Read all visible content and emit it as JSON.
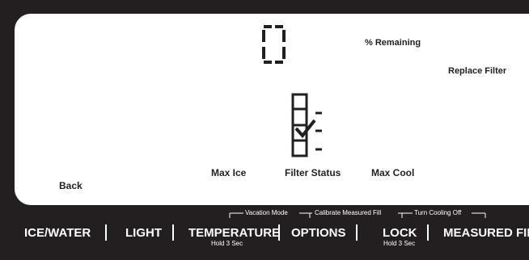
{
  "display": {
    "remaining_digit": "0",
    "remaining_label": "% Remaining",
    "replace_filter_label": "Replace Filter",
    "back_label": "Back",
    "max_ice_label": "Max  Ice",
    "filter_status_label": "Filter Status",
    "max_cool_label": "Max Cool",
    "filter_status_icon": "filter-status-icon"
  },
  "controls": {
    "hold_labels": {
      "vacation_mode": "Vacation Mode",
      "calibrate_measured_fill": "Calibrate Measured Fill",
      "turn_cooling_off": "Turn Cooling Off"
    },
    "buttons": [
      {
        "label": "ICE/WATER",
        "sub": ""
      },
      {
        "label": "LIGHT",
        "sub": ""
      },
      {
        "label": "TEMPERATURE",
        "sub": "Hold 3 Sec"
      },
      {
        "label": "OPTIONS",
        "sub": ""
      },
      {
        "label": "LOCK",
        "sub": "Hold 3 Sec"
      },
      {
        "label": "MEASURED FILL",
        "sub": ""
      }
    ]
  },
  "colors": {
    "panel_dark": "#231f20",
    "display_bg": "#ffffff",
    "button_text": "#ffffff"
  }
}
